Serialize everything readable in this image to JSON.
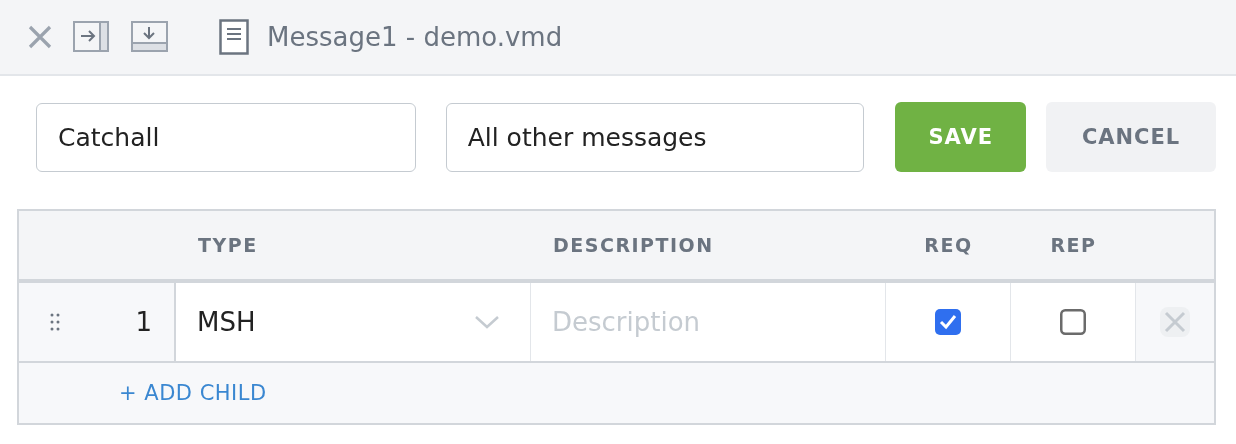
{
  "toolbar": {
    "title": "Message1 - demo.vmd"
  },
  "form": {
    "name": "Catchall",
    "description": "All other messages",
    "save": "SAVE",
    "cancel": "CANCEL"
  },
  "table": {
    "columns": [
      "TYPE",
      "DESCRIPTION",
      "REQ",
      "REP"
    ],
    "rows": [
      {
        "number": "1",
        "type": "MSH",
        "description_placeholder": "Description",
        "required": true,
        "repeating": false
      }
    ],
    "add_child": "+ ADD CHILD"
  }
}
